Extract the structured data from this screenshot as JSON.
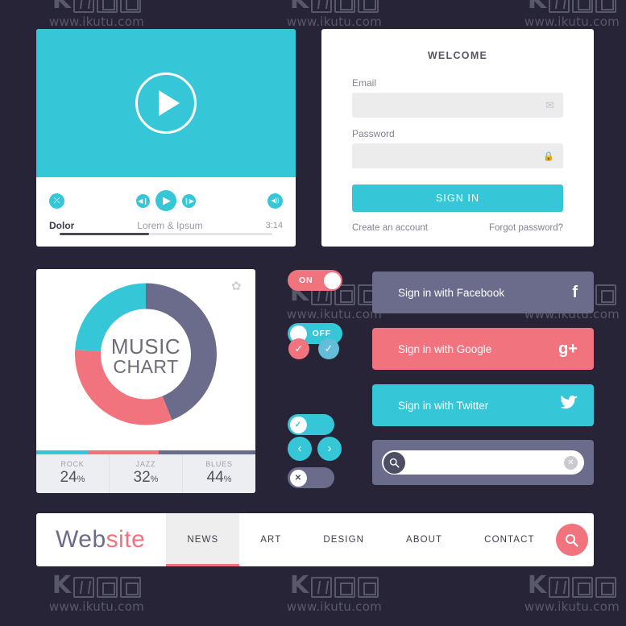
{
  "watermark": {
    "url": "www.ikutu.com",
    "mark": "K酷图网"
  },
  "player": {
    "play_icon": "play-icon",
    "shuffle_icon": "shuffle-icon",
    "prev_icon": "previous-icon",
    "play_small_icon": "play-icon",
    "next_icon": "next-icon",
    "volume_icon": "volume-icon",
    "shuffle_glyph": "⤫",
    "prev_glyph": "◀❙",
    "play_glyph": "▶",
    "next_glyph": "❙▶",
    "volume_glyph": "◀))",
    "title": "Dolor",
    "subtitle": "Lorem & Ipsum",
    "time": "3:14",
    "progress_percent": 42
  },
  "login": {
    "heading": "WELCOME",
    "email_label": "Email",
    "email_value": "",
    "email_placeholder": "",
    "email_icon_glyph": "✉",
    "password_label": "Password",
    "password_value": "",
    "password_placeholder": "",
    "password_icon_glyph": "🔒",
    "signin_label": "SIGN IN",
    "create_account": "Create an account",
    "forgot_password": "Forgot password?"
  },
  "chart_data": {
    "type": "pie",
    "title": "MUSIC CHART",
    "title_line1": "MUSIC",
    "title_line2": "CHART",
    "categories": [
      "ROCK",
      "JAZZ",
      "BLUES"
    ],
    "values": [
      24,
      32,
      44
    ],
    "unit": "%",
    "colors": [
      "#35c6d7",
      "#f0737e",
      "#6b6b8c"
    ],
    "legend_position": "bottom",
    "start_angle_deg": 0,
    "draw_order": [
      "BLUES",
      "JAZZ",
      "ROCK"
    ],
    "gear_icon_glyph": "✿"
  },
  "controls": {
    "toggle_on_label": "ON",
    "toggle_off_label": "OFF",
    "check_glyph": "✓",
    "cross_glyph": "✕",
    "arrow_left_glyph": "‹",
    "arrow_right_glyph": "›"
  },
  "social": [
    {
      "label": "Sign in with Facebook",
      "brand_glyph": "f",
      "color": "#6b6b8c",
      "name": "facebook"
    },
    {
      "label": "Sign in with Google",
      "brand_glyph": "g+",
      "color": "#f0737e",
      "name": "google"
    },
    {
      "label": "Sign in with Twitter",
      "brand_glyph": "🐦",
      "color": "#35c6d7",
      "name": "twitter"
    }
  ],
  "search": {
    "value": "",
    "placeholder": "",
    "search_glyph": "🔍",
    "clear_glyph": "✕"
  },
  "navbar": {
    "logo_part1": "Web",
    "logo_part2": "site",
    "items": [
      {
        "label": "NEWS",
        "active": true
      },
      {
        "label": "ART",
        "active": false
      },
      {
        "label": "DESIGN",
        "active": false
      },
      {
        "label": "ABOUT",
        "active": false
      },
      {
        "label": "CONTACT",
        "active": false
      }
    ],
    "search_glyph": "🔍"
  },
  "theme": {
    "background": "#262436",
    "teal": "#35c6d7",
    "coral": "#f0737e",
    "purple": "#6b6b8c"
  }
}
